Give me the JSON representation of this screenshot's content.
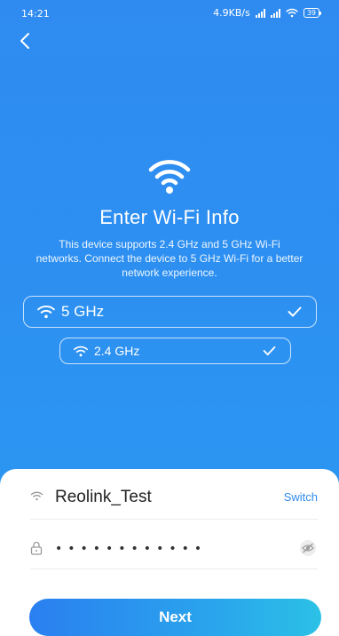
{
  "status_bar": {
    "time": "14:21",
    "net_speed": "4.9KB/s",
    "battery": "39"
  },
  "header": {
    "back_icon": "chevron-left-icon"
  },
  "hero": {
    "icon": "wifi-icon",
    "title": "Enter Wi-Fi Info",
    "description": "This device supports 2.4 GHz and 5 GHz Wi-Fi networks. Connect the device to 5 GHz Wi-Fi for a better network experience."
  },
  "bands": [
    {
      "label": "5 GHz",
      "icon": "wifi-icon",
      "status_icon": "check-icon"
    },
    {
      "label": "2.4 GHz",
      "icon": "wifi-icon",
      "status_icon": "check-icon"
    }
  ],
  "form": {
    "ssid": "Reolink_Test",
    "switch_label": "Switch",
    "password_value": "••••••••••••",
    "password_icon": "lock-icon",
    "visibility_icon": "eye-off-icon"
  },
  "next_label": "Next",
  "colors": {
    "primary": "#2f8bf0",
    "accent_end": "#2bc1e6"
  }
}
